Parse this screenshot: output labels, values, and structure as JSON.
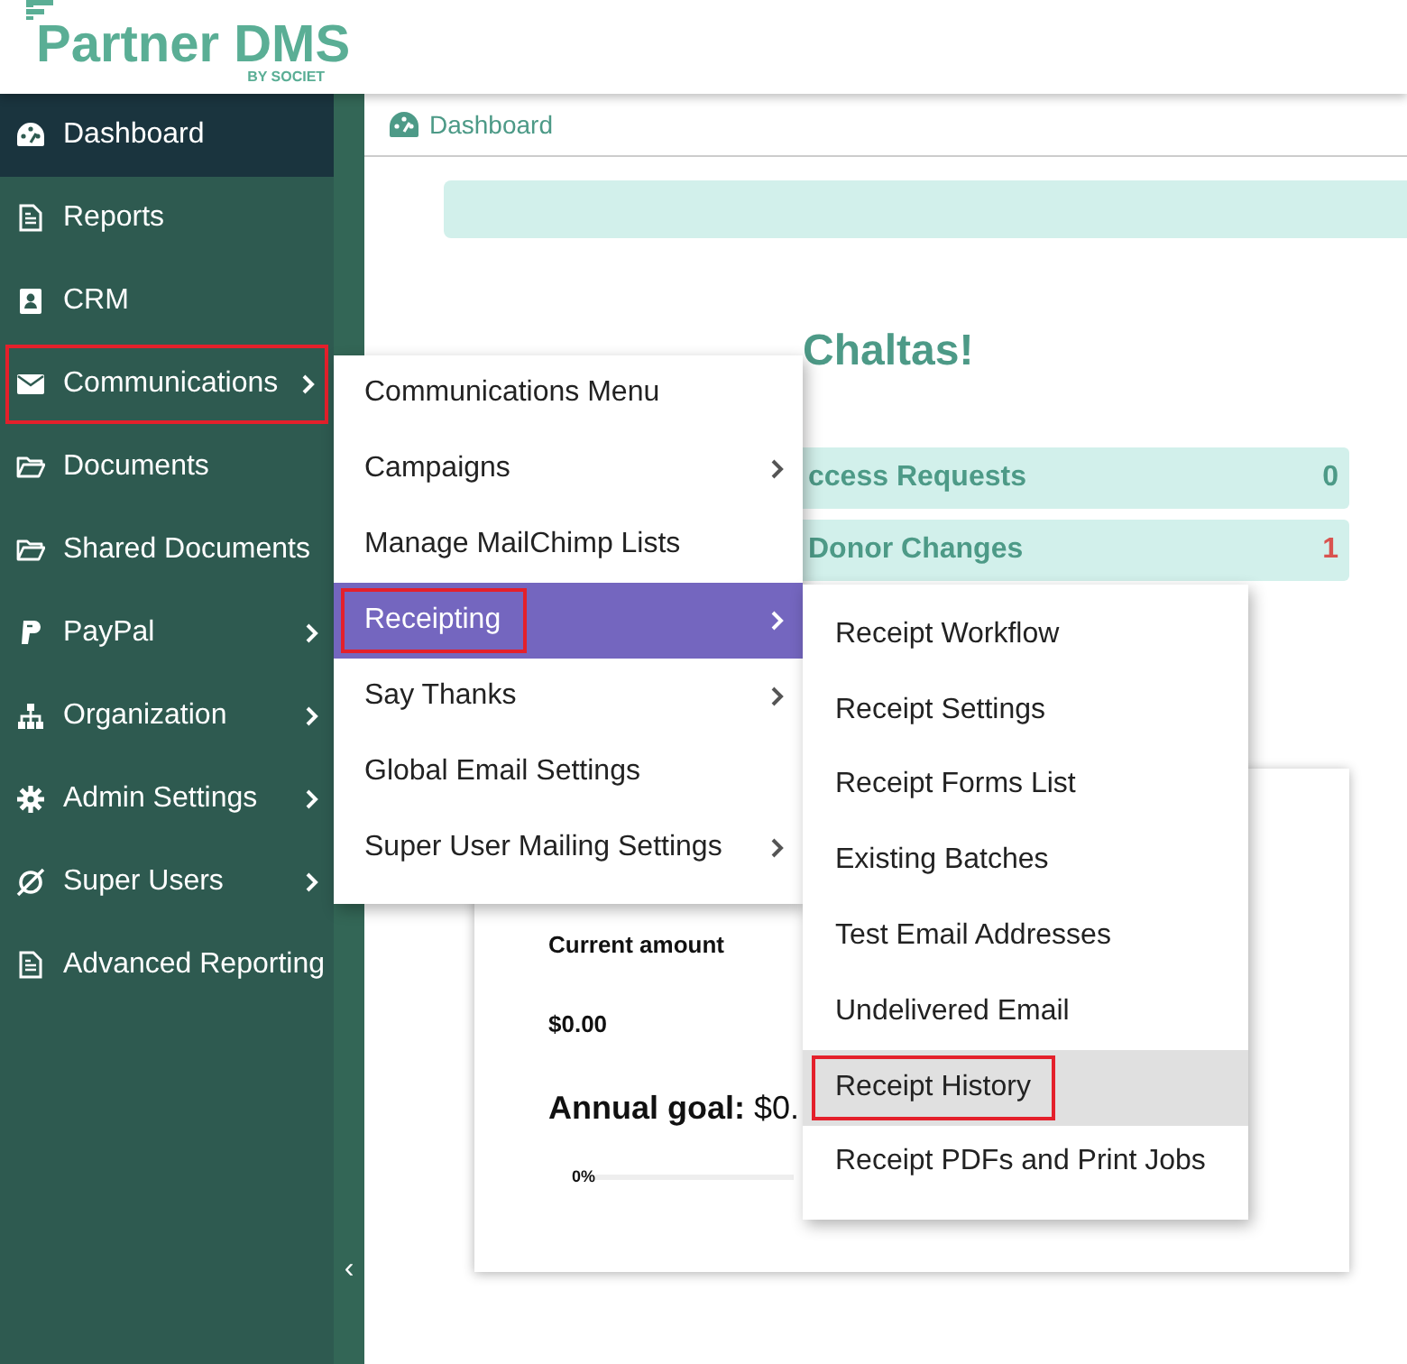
{
  "logo": {
    "name": "Partner DMS",
    "byline": "BY SOCIET"
  },
  "sidebar": {
    "items": [
      {
        "label": "Dashboard",
        "selected": true,
        "submenu": false,
        "highlighted": false
      },
      {
        "label": "Reports",
        "selected": false,
        "submenu": false,
        "highlighted": false
      },
      {
        "label": "CRM",
        "selected": false,
        "submenu": false,
        "highlighted": false
      },
      {
        "label": "Communications",
        "selected": false,
        "submenu": true,
        "highlighted": true
      },
      {
        "label": "Documents",
        "selected": false,
        "submenu": false,
        "highlighted": false
      },
      {
        "label": "Shared Documents",
        "selected": false,
        "submenu": false,
        "highlighted": false
      },
      {
        "label": "PayPal",
        "selected": false,
        "submenu": true,
        "highlighted": false
      },
      {
        "label": "Organization",
        "selected": false,
        "submenu": true,
        "highlighted": false
      },
      {
        "label": "Admin Settings",
        "selected": false,
        "submenu": true,
        "highlighted": false
      },
      {
        "label": "Super Users",
        "selected": false,
        "submenu": true,
        "highlighted": false
      },
      {
        "label": "Advanced Reporting",
        "selected": false,
        "submenu": false,
        "highlighted": false
      }
    ],
    "collapse": "‹"
  },
  "breadcrumb": "Dashboard",
  "welcome": "Chaltas!",
  "stats": [
    {
      "label": "ccess Requests",
      "count": "0",
      "alert": false
    },
    {
      "label": "Donor Changes",
      "count": "1",
      "alert": true
    }
  ],
  "account_card": {
    "current_label": "Current amount",
    "current_value": "$0.00",
    "goal": "**Annual goal:** $0.",
    "progress": {
      "level": 0,
      "reading": "0%"
    }
  },
  "menu": [
    {
      "label": "Communications Menu",
      "submenu": false,
      "selected": false,
      "highlighted": false
    },
    {
      "label": "Campaigns",
      "submenu": true,
      "selected": false,
      "highlighted": false
    },
    {
      "label": "Manage MailChimp Lists",
      "submenu": false,
      "selected": false,
      "highlighted": false
    },
    {
      "label": "Receipting",
      "submenu": true,
      "selected": true,
      "highlighted": true
    },
    {
      "label": "Say Thanks",
      "submenu": true,
      "selected": false,
      "highlighted": false
    },
    {
      "label": "Global Email Settings",
      "submenu": false,
      "selected": false,
      "highlighted": false
    },
    {
      "label": "Super User Mailing Settings",
      "submenu": true,
      "selected": false,
      "highlighted": false
    }
  ],
  "submenu": [
    {
      "label": "Receipt Workflow",
      "selected": false,
      "highlighted": false
    },
    {
      "label": "Receipt Settings",
      "selected": false,
      "highlighted": false
    },
    {
      "label": "Receipt Forms List",
      "selected": false,
      "highlighted": false
    },
    {
      "label": "Existing Batches",
      "selected": false,
      "highlighted": false
    },
    {
      "label": "Test Email Addresses",
      "selected": false,
      "highlighted": false
    },
    {
      "label": "Undelivered Email",
      "selected": false,
      "highlighted": false
    },
    {
      "label": "Receipt History",
      "selected": true,
      "highlighted": true
    },
    {
      "label": "Receipt PDFs and Print Jobs",
      "selected": false,
      "highlighted": false
    }
  ]
}
